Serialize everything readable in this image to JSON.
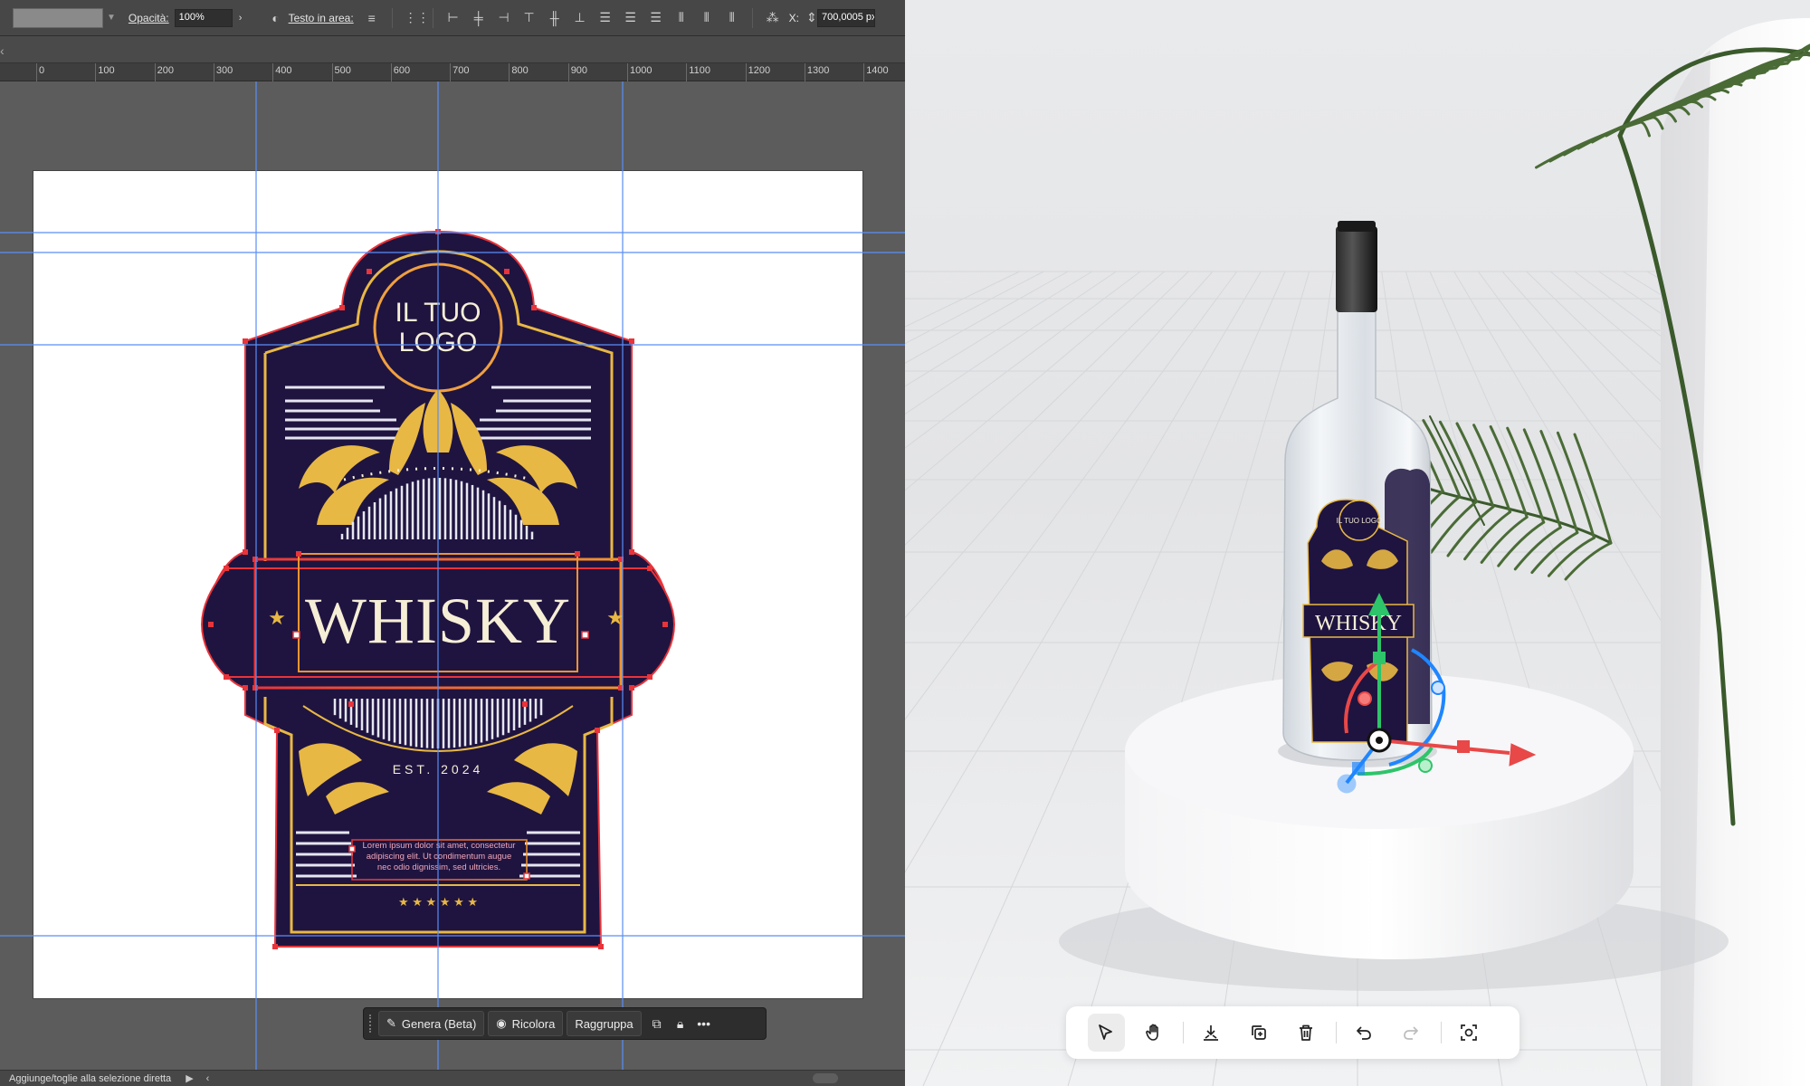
{
  "editor": {
    "control_bar": {
      "opacity_label": "Opacità:",
      "opacity_value": "100%",
      "area_text_label": "Testo in area:",
      "x_label": "X:",
      "x_value": "700,0005 px"
    },
    "ruler": {
      "labels": [
        "0",
        "100",
        "200",
        "300",
        "400",
        "500",
        "600",
        "700",
        "800",
        "900",
        "1000",
        "1100",
        "1200",
        "1300",
        "1400"
      ]
    },
    "label_art": {
      "logo_line1": "IL TUO",
      "logo_line2": "LOGO",
      "title": "WHISKY",
      "est": "EST. 2024",
      "lorem_line1": "Lorem ipsum dolor sit amet, consectetur",
      "lorem_line2": "adipiscing elit. Ut condimentum augue",
      "lorem_line3": "nec odio dignissim, sed ultricies.",
      "stars": "★ ★ ★ ★ ★ ★"
    },
    "context_bar": {
      "generate_label": "Genera (Beta)",
      "recolor_label": "Ricolora",
      "group_label": "Raggruppa"
    },
    "status_bar": {
      "text": "Aggiunge/toglie alla selezione diretta"
    }
  },
  "scene": {
    "bottle_label": {
      "logo": "IL TUO LOGO",
      "title": "WHISKY"
    },
    "toolbar": {
      "tools": [
        "select",
        "hand",
        "place-on-ground",
        "duplicate",
        "delete",
        "undo",
        "redo",
        "focus"
      ]
    }
  },
  "colors": {
    "label_navy": "#1f1440",
    "label_gold": "#e8b844",
    "label_cream": "#f6efd6",
    "selection_red": "#e8343a",
    "guide_blue": "#5a8ef5",
    "gizmo_red": "#e84848",
    "gizmo_green": "#2ec46a",
    "gizmo_blue": "#1f86ff"
  }
}
